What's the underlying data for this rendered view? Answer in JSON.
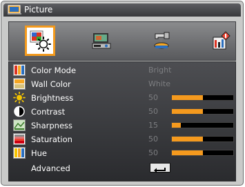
{
  "window": {
    "title": "Picture"
  },
  "tabs": [
    {
      "name": "picture",
      "selected": true
    },
    {
      "name": "display",
      "selected": false
    },
    {
      "name": "setup",
      "selected": false
    },
    {
      "name": "options",
      "selected": false
    }
  ],
  "menu": {
    "color_mode": {
      "label": "Color Mode",
      "value": "Bright"
    },
    "wall_color": {
      "label": "Wall Color",
      "value": "White"
    },
    "brightness": {
      "label": "Brightness",
      "value": "50",
      "level": 0.5
    },
    "contrast": {
      "label": "Contrast",
      "value": "50",
      "level": 0.5
    },
    "sharpness": {
      "label": "Sharpness",
      "value": "15",
      "level": 0.15
    },
    "saturation": {
      "label": "Saturation",
      "value": "50",
      "level": 0.5
    },
    "hue": {
      "label": "Hue",
      "value": "50",
      "level": 0.5
    },
    "advanced": {
      "label": "Advanced"
    }
  },
  "colors": {
    "accent": "#f59a1e",
    "value_text": "#7d7e81"
  },
  "icons": [
    "picture-icon",
    "display-icon",
    "setup-icon",
    "options-icon",
    "color-mode-icon",
    "wall-color-icon",
    "brightness-icon",
    "contrast-icon",
    "sharpness-icon",
    "saturation-icon",
    "hue-icon",
    "enter-icon"
  ]
}
